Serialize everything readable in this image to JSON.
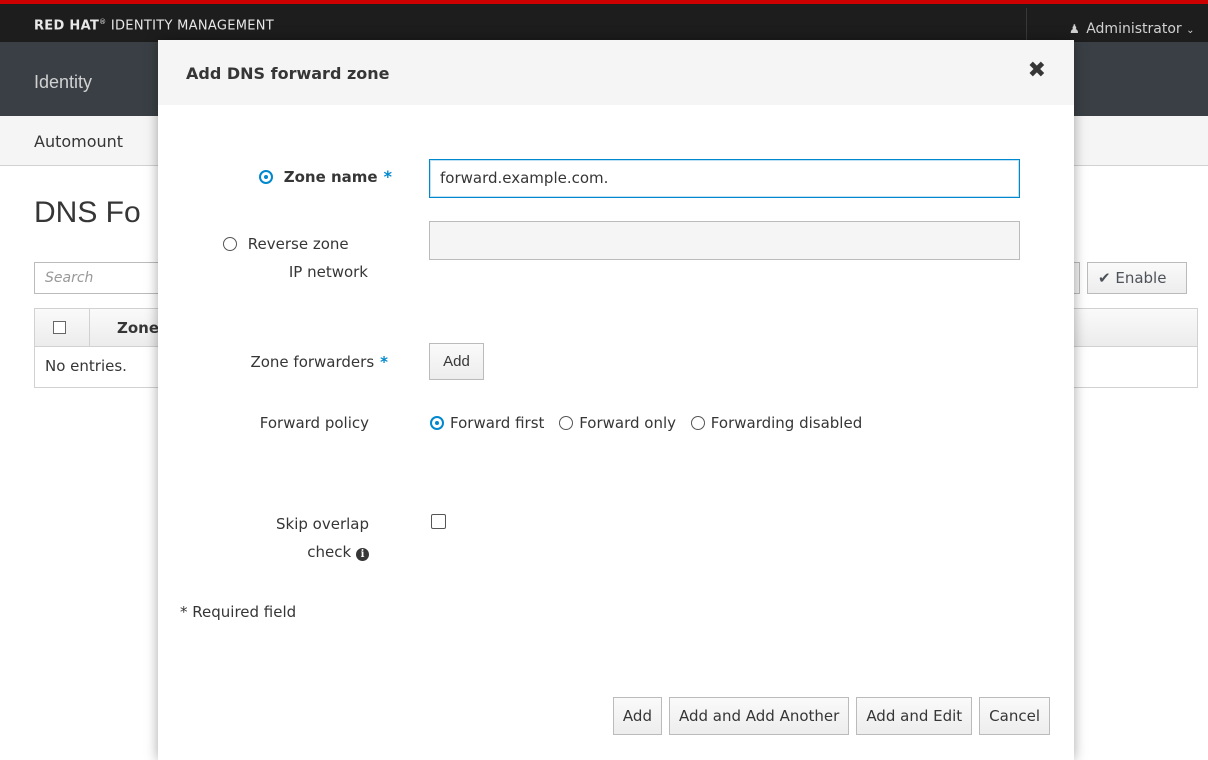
{
  "app": {
    "brand_bold": "RED HAT",
    "brand_mark": "®",
    "brand_rest": "IDENTITY MANAGEMENT",
    "user": "Administrator",
    "user_icon": "user-icon",
    "user_chevron": "chevron-down-icon"
  },
  "nav": {
    "identity": "Identity",
    "automount": "Automount"
  },
  "page": {
    "title": "DNS Fo",
    "search_placeholder": "Search",
    "enable_label": "Enable",
    "table_header": "Zone n",
    "empty_text": "No entries."
  },
  "modal": {
    "title": "Add DNS forward zone",
    "close_glyph": "✖",
    "zone_name_label": "Zone name",
    "required_mark": "*",
    "zone_name_value": "forward.example.com.",
    "reverse_label_line1": "Reverse zone",
    "reverse_label_line2": "IP network",
    "reverse_value": "",
    "forwarders_label": "Zone forwarders",
    "add_forwarder_label": "Add",
    "policy_label": "Forward policy",
    "policy_options": [
      "Forward first",
      "Forward only",
      "Forwarding disabled"
    ],
    "policy_selected": "Forward first",
    "skip_label_line1": "Skip overlap",
    "skip_label_line2": "check",
    "skip_checked": false,
    "required_note": "* Required field",
    "buttons": {
      "add": "Add",
      "add_another": "Add and Add Another",
      "add_edit": "Add and Edit",
      "cancel": "Cancel"
    }
  },
  "colors": {
    "accent": "#0088ce",
    "top_border": "#cc0000",
    "navbar": "#393f44"
  }
}
